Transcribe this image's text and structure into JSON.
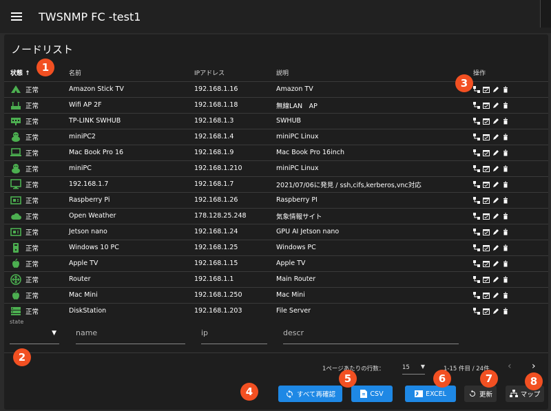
{
  "app": {
    "title": "TWSNMP FC -test1"
  },
  "page": {
    "title": "ノードリスト"
  },
  "columns": {
    "state": "状態",
    "name": "名前",
    "ip": "IPアドレス",
    "descr": "説明",
    "actions": "操作"
  },
  "rows": [
    {
      "icon": "triangle-icon",
      "state": "正常",
      "name": "Amazon Stick TV",
      "ip": "192.168.1.16",
      "descr": "Amazon TV"
    },
    {
      "icon": "wifi-router-icon",
      "state": "正常",
      "name": "Wifi AP 2F",
      "ip": "192.168.1.18",
      "descr": "無線LAN　AP"
    },
    {
      "icon": "switch-hub-icon",
      "state": "正常",
      "name": "TP-LINK SWHUB",
      "ip": "192.168.1.3",
      "descr": "SWHUB"
    },
    {
      "icon": "linux-icon",
      "state": "正常",
      "name": "miniPC2",
      "ip": "192.168.1.4",
      "descr": "miniPC Linux"
    },
    {
      "icon": "laptop-icon",
      "state": "正常",
      "name": "Mac Book Pro 16",
      "ip": "192.168.1.9",
      "descr": "Mac Book Pro 16inch"
    },
    {
      "icon": "linux-icon",
      "state": "正常",
      "name": "miniPC",
      "ip": "192.168.1.210",
      "descr": "miniPC Linux"
    },
    {
      "icon": "desktop-icon",
      "state": "正常",
      "name": "192.168.1.7",
      "ip": "192.168.1.7",
      "descr": "2021/07/06に発見 / ssh,cifs,kerberos,vnc対応"
    },
    {
      "icon": "board-icon",
      "state": "正常",
      "name": "Raspberry Pi",
      "ip": "192.168.1.26",
      "descr": "Raspberry PI"
    },
    {
      "icon": "cloud-icon",
      "state": "正常",
      "name": "Open Weather",
      "ip": "178.128.25.248",
      "descr": "気象情報サイト"
    },
    {
      "icon": "board-icon",
      "state": "正常",
      "name": "Jetson nano",
      "ip": "192.168.1.24",
      "descr": "GPU AI Jetson nano"
    },
    {
      "icon": "windows-pc-icon",
      "state": "正常",
      "name": "Windows 10 PC",
      "ip": "192.168.1.25",
      "descr": "Windows PC"
    },
    {
      "icon": "apple-icon",
      "state": "正常",
      "name": "Apple TV",
      "ip": "192.168.1.15",
      "descr": "Apple TV"
    },
    {
      "icon": "router-icon",
      "state": "正常",
      "name": "Router",
      "ip": "192.168.1.1",
      "descr": "Main Router"
    },
    {
      "icon": "apple-icon",
      "state": "正常",
      "name": "Mac Mini",
      "ip": "192.168.1.250",
      "descr": "Mac Mini"
    },
    {
      "icon": "nas-icon",
      "state": "正常",
      "name": "DiskStation",
      "ip": "192.168.1.203",
      "descr": "File Server"
    }
  ],
  "filters": {
    "state_label": "state",
    "name_placeholder": "name",
    "ip_placeholder": "ip",
    "descr_placeholder": "descr"
  },
  "pager": {
    "rows_per_page_label": "1ページあたりの行数：",
    "rows_per_page": "15",
    "range": "1-15 件目 / 24件"
  },
  "buttons": {
    "recheck_all": "すべて再確認",
    "csv": "CSV",
    "excel": "EXCEL",
    "refresh": "更新",
    "map": "マップ"
  },
  "badges": [
    "1",
    "2",
    "3",
    "4",
    "5",
    "6",
    "7",
    "8"
  ],
  "colors": {
    "status_ok": "#4caf50",
    "button_blue": "#1e88e5",
    "badge": "#f25022"
  }
}
